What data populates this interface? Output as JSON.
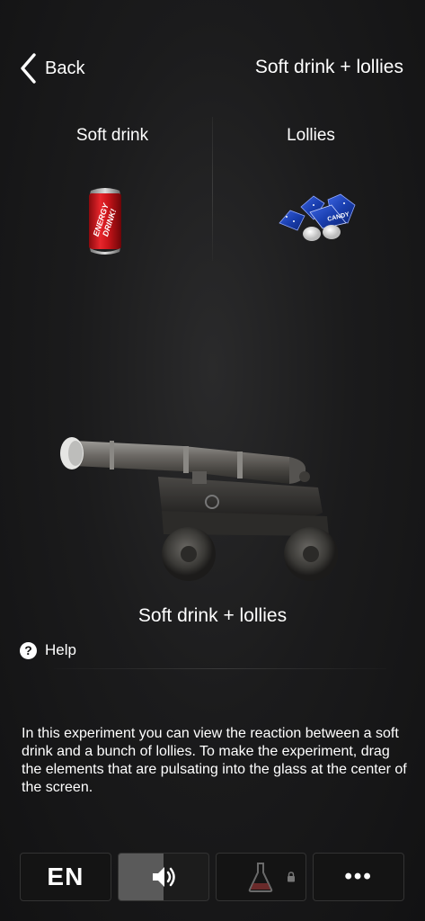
{
  "header": {
    "back_label": "Back",
    "title": "Soft drink + lollies"
  },
  "ingredients": [
    {
      "label": "Soft drink",
      "can_text_1": "ENERGY",
      "can_text_2": "DRINK!"
    },
    {
      "label": "Lollies",
      "wrapper_text": "CANDY"
    }
  ],
  "experiment": {
    "title": "Soft drink + lollies",
    "help_label": "Help",
    "help_icon_glyph": "?",
    "description": "In this experiment you can view the reaction between a soft drink and a bunch of lollies. To make the experiment, drag the elements that are pulsating into the glass at the center of the screen."
  },
  "tabbar": {
    "language_label": "EN",
    "more_glyph": "•••",
    "icons": [
      "language",
      "speaker-icon",
      "flask-icon",
      "lock-icon",
      "more-icon"
    ]
  },
  "colors": {
    "background": "#1b1b1c",
    "text": "#ffffff",
    "can_red": "#d2141a",
    "lolly_blue": "#1a3fb0"
  }
}
